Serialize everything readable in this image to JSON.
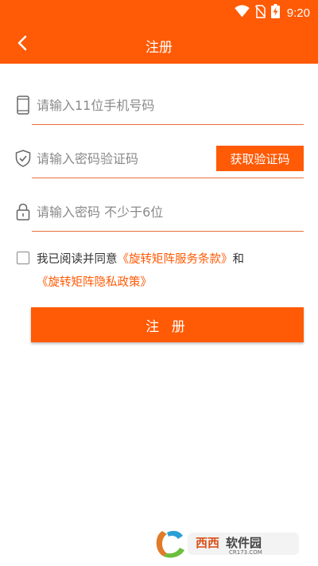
{
  "status_bar": {
    "time": "9:20",
    "icons": [
      "wifi-icon",
      "no-sim-icon",
      "battery-charging-icon"
    ]
  },
  "app_bar": {
    "title": "注册",
    "back_icon": "chevron-left-icon"
  },
  "form": {
    "phone": {
      "placeholder": "请输入11位手机号码",
      "value": "",
      "icon": "phone-icon"
    },
    "code": {
      "placeholder": "请输入密码验证码",
      "value": "",
      "icon": "shield-check-icon",
      "button_label": "获取验证码"
    },
    "password": {
      "placeholder": "请输入密码 不少于6位",
      "value": "",
      "icon": "lock-icon"
    }
  },
  "agreement": {
    "checked": false,
    "prefix": "我已阅读并同意",
    "terms_link": "《旋转矩阵服务条款》",
    "conjunction": "和",
    "privacy_link": "《旋转矩阵隐私政策》"
  },
  "register_button": {
    "label": "注 册"
  },
  "watermark": {
    "text": "西西软件园",
    "subtext": "CR173.COM"
  },
  "colors": {
    "accent": "#ff5a05",
    "divider": "#e8703a",
    "placeholder": "#8a8a8a"
  }
}
